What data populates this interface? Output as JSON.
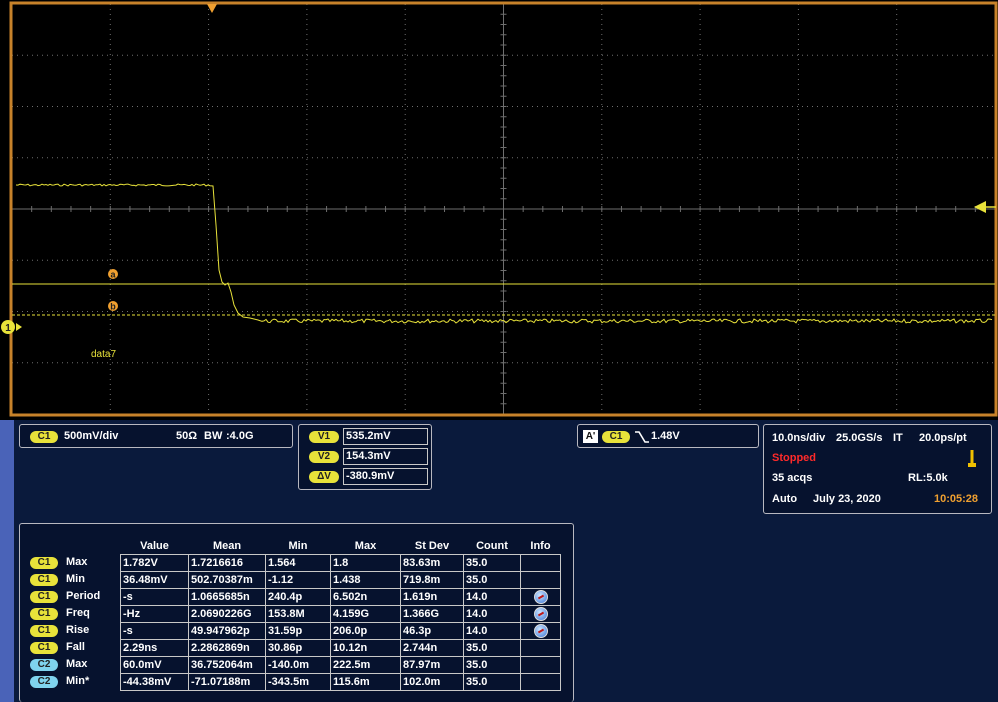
{
  "graticule": {
    "channel_marker": "1",
    "cursor_a_label": "a",
    "cursor_b_label": "b",
    "trace_label": "data7"
  },
  "channel_panel": {
    "badge": "C1",
    "scale": "500mV/div",
    "impedance": "50Ω",
    "bw_label": "BW",
    "bandwidth": ":4.0G"
  },
  "cursors": [
    {
      "label": "V1",
      "value": "535.2mV"
    },
    {
      "label": "V2",
      "value": "154.3mV"
    },
    {
      "label": "ΔV",
      "value": "-380.9mV"
    }
  ],
  "trigger": {
    "mode_badge": "A'",
    "channel_badge": "C1",
    "level": "1.48V"
  },
  "horizontal": {
    "time_div": "10.0ns/div",
    "sample_rate": "25.0GS/s",
    "mode": "IT",
    "resolution": "20.0ps/pt",
    "status": "Stopped",
    "acqs": "35 acqs",
    "record_length": "RL:5.0k",
    "trigger_mode": "Auto",
    "date": "July 23, 2020",
    "time": "10:05:28"
  },
  "measurements": {
    "headers": [
      "Value",
      "Mean",
      "Min",
      "Max",
      "St Dev",
      "Count",
      "Info"
    ],
    "rows": [
      {
        "ch": "C1",
        "name": "Max",
        "value": "1.782V",
        "mean": "1.7216616",
        "min": "1.564",
        "max": "1.8",
        "stdev": "83.63m",
        "count": "35.0",
        "info": false
      },
      {
        "ch": "C1",
        "name": "Min",
        "value": "36.48mV",
        "mean": "502.70387m",
        "min": "-1.12",
        "max": "1.438",
        "stdev": "719.8m",
        "count": "35.0",
        "info": false
      },
      {
        "ch": "C1",
        "name": "Period",
        "value": "-s",
        "mean": "1.0665685n",
        "min": "240.4p",
        "max": "6.502n",
        "stdev": "1.619n",
        "count": "14.0",
        "info": true
      },
      {
        "ch": "C1",
        "name": "Freq",
        "value": "-Hz",
        "mean": "2.0690226G",
        "min": "153.8M",
        "max": "4.159G",
        "stdev": "1.366G",
        "count": "14.0",
        "info": true
      },
      {
        "ch": "C1",
        "name": "Rise",
        "value": "-s",
        "mean": "49.947962p",
        "min": "31.59p",
        "max": "206.0p",
        "stdev": "46.3p",
        "count": "14.0",
        "info": true
      },
      {
        "ch": "C1",
        "name": "Fall",
        "value": "2.29ns",
        "mean": "2.2862869n",
        "min": "30.86p",
        "max": "10.12n",
        "stdev": "2.744n",
        "count": "35.0",
        "info": false
      },
      {
        "ch": "C2",
        "name": "Max",
        "value": "60.0mV",
        "mean": "36.752064m",
        "min": "-140.0m",
        "max": "222.5m",
        "stdev": "87.97m",
        "count": "35.0",
        "info": false
      },
      {
        "ch": "C2",
        "name": "Min*",
        "value": "-44.38mV",
        "mean": "-71.07188m",
        "min": "-343.5m",
        "max": "115.6m",
        "stdev": "102.0m",
        "count": "35.0",
        "info": false
      }
    ]
  },
  "colors": {
    "c1_yellow": "#e8e23a",
    "c2_blue": "#7fd3ee",
    "frame_orange": "#c7822a",
    "stopped_red": "#ff2a2a",
    "time_orange": "#f0a030"
  }
}
